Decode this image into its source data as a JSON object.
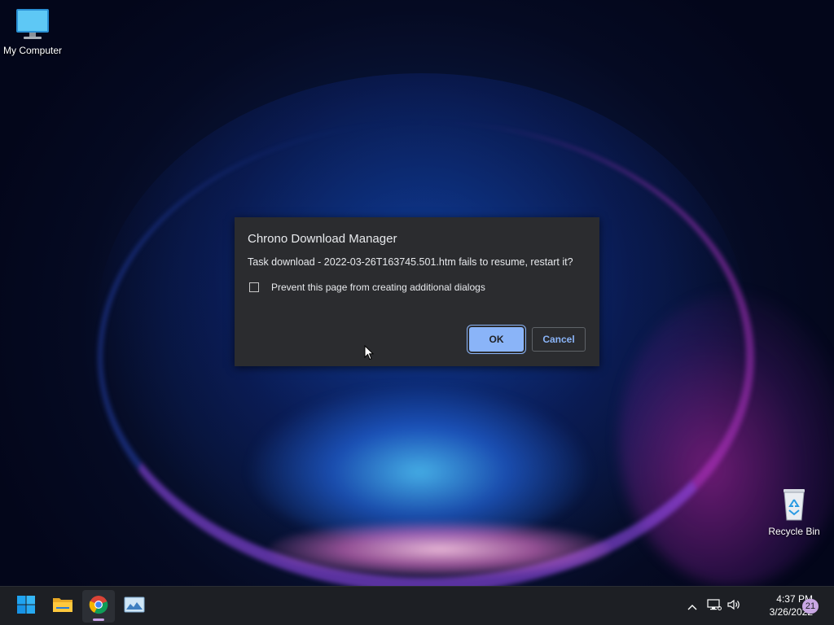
{
  "desktop": {
    "icons": [
      {
        "label": "My Computer",
        "icon": "computer-icon"
      },
      {
        "label": "Recycle Bin",
        "icon": "recycle-bin-icon"
      }
    ]
  },
  "dialog": {
    "title": "Chrono Download Manager",
    "message": "Task download - 2022-03-26T163745.501.htm fails to resume, restart it?",
    "checkbox_label": "Prevent this page from creating additional dialogs",
    "checkbox_checked": false,
    "ok_label": "OK",
    "cancel_label": "Cancel"
  },
  "taskbar": {
    "apps": [
      {
        "name": "start",
        "icon": "windows-start-icon"
      },
      {
        "name": "file-explorer",
        "icon": "folder-icon"
      },
      {
        "name": "chrome",
        "icon": "chrome-icon",
        "active": true
      },
      {
        "name": "image-viewer",
        "icon": "image-icon"
      }
    ],
    "tray": {
      "icons": [
        "chevron-up-icon",
        "network-icon",
        "volume-icon"
      ],
      "time": "4:37 PM",
      "date": "3/26/2022",
      "notification_count": "21"
    }
  },
  "colors": {
    "dialog_bg": "#2b2c2f",
    "accent": "#8ab4f8",
    "taskbar_bg": "#1d1f24",
    "badge": "#c9a7e4"
  }
}
